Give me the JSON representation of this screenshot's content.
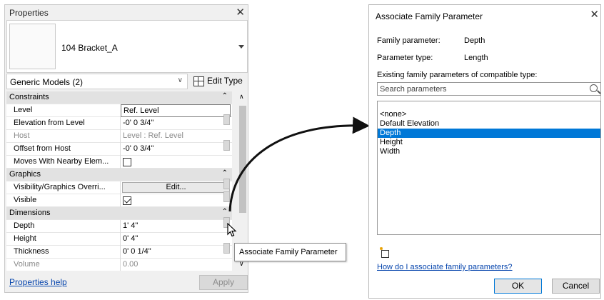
{
  "properties": {
    "title": "Properties",
    "close_symbol": "✕",
    "type_name": "104 Bracket_A",
    "filter_label": "Generic Models (2)",
    "filter_caret": "∨",
    "edit_type_label": "Edit Type",
    "collapse_symbol": "⌃",
    "rows": [
      {
        "type": "group",
        "label": "Constraints"
      },
      {
        "type": "input",
        "label": "Level",
        "value": "Ref. Level"
      },
      {
        "type": "text",
        "label": "Elevation from Level",
        "value": "-0'  0 3/4\""
      },
      {
        "type": "dim",
        "label": "Host",
        "value": "Level : Ref. Level"
      },
      {
        "type": "text",
        "label": "Offset from Host",
        "value": "-0'  0 3/4\""
      },
      {
        "type": "check",
        "label": "Moves With Nearby Elem...",
        "checked": false
      },
      {
        "type": "group",
        "label": "Graphics"
      },
      {
        "type": "button",
        "label": "Visibility/Graphics Overri...",
        "value": "Edit..."
      },
      {
        "type": "check",
        "label": "Visible",
        "checked": true
      },
      {
        "type": "group",
        "label": "Dimensions"
      },
      {
        "type": "text",
        "label": "Depth",
        "value": "1'  4\""
      },
      {
        "type": "text",
        "label": "Height",
        "value": "0'  4\""
      },
      {
        "type": "text",
        "label": "Thickness",
        "value": "0'  0 1/4\""
      },
      {
        "type": "dim",
        "label": "Volume",
        "value": "0.00"
      }
    ],
    "help_link": "Properties help",
    "apply_label": "Apply"
  },
  "tooltip": {
    "text": "Associate Family Parameter"
  },
  "dialog": {
    "title": "Associate Family Parameter",
    "close_symbol": "✕",
    "family_parameter_label": "Family parameter:",
    "family_parameter_value": "Depth",
    "parameter_type_label": "Parameter type:",
    "parameter_type_value": "Length",
    "existing_label": "Existing family parameters of compatible type:",
    "search_placeholder": "Search parameters",
    "list_items": [
      "<none>",
      "Default Elevation",
      "Depth",
      "Height",
      "Width"
    ],
    "selected_index": 2,
    "help_link": "How do I associate family parameters?",
    "ok_label": "OK",
    "cancel_label": "Cancel"
  },
  "colors": {
    "selection": "#0078d7",
    "link": "#0645ad",
    "group_header": "#e2e2e2"
  }
}
